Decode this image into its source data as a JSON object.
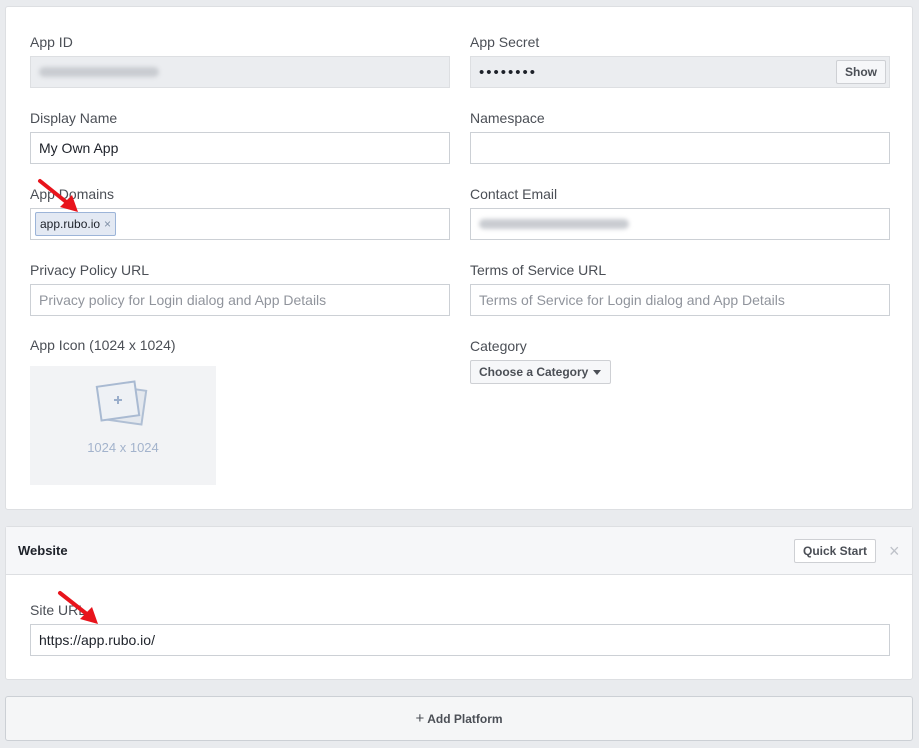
{
  "basic": {
    "app_id_label": "App ID",
    "app_secret_label": "App Secret",
    "app_secret_value": "••••••••",
    "show_label": "Show",
    "display_name_label": "Display Name",
    "display_name_value": "My Own App",
    "namespace_label": "Namespace",
    "app_domains_label": "App Domains",
    "app_domain_token": "app.rubo.io",
    "token_remove": "×",
    "contact_email_label": "Contact Email",
    "privacy_label": "Privacy Policy URL",
    "privacy_placeholder": "Privacy policy for Login dialog and App Details",
    "tos_label": "Terms of Service URL",
    "tos_placeholder": "Terms of Service for Login dialog and App Details",
    "icon_label": "App Icon (1024 x 1024)",
    "icon_size_text": "1024 x 1024",
    "category_label": "Category",
    "category_button": "Choose a Category"
  },
  "website": {
    "title": "Website",
    "quick_start_label": "Quick Start",
    "close_symbol": "×",
    "site_url_label": "Site URL",
    "site_url_value": "https://app.rubo.io/"
  },
  "add_platform": {
    "label": "Add Platform",
    "plus": "+"
  },
  "colors": {
    "accent_arrow": "#e8141c",
    "token_bg": "#e3e9f3"
  }
}
